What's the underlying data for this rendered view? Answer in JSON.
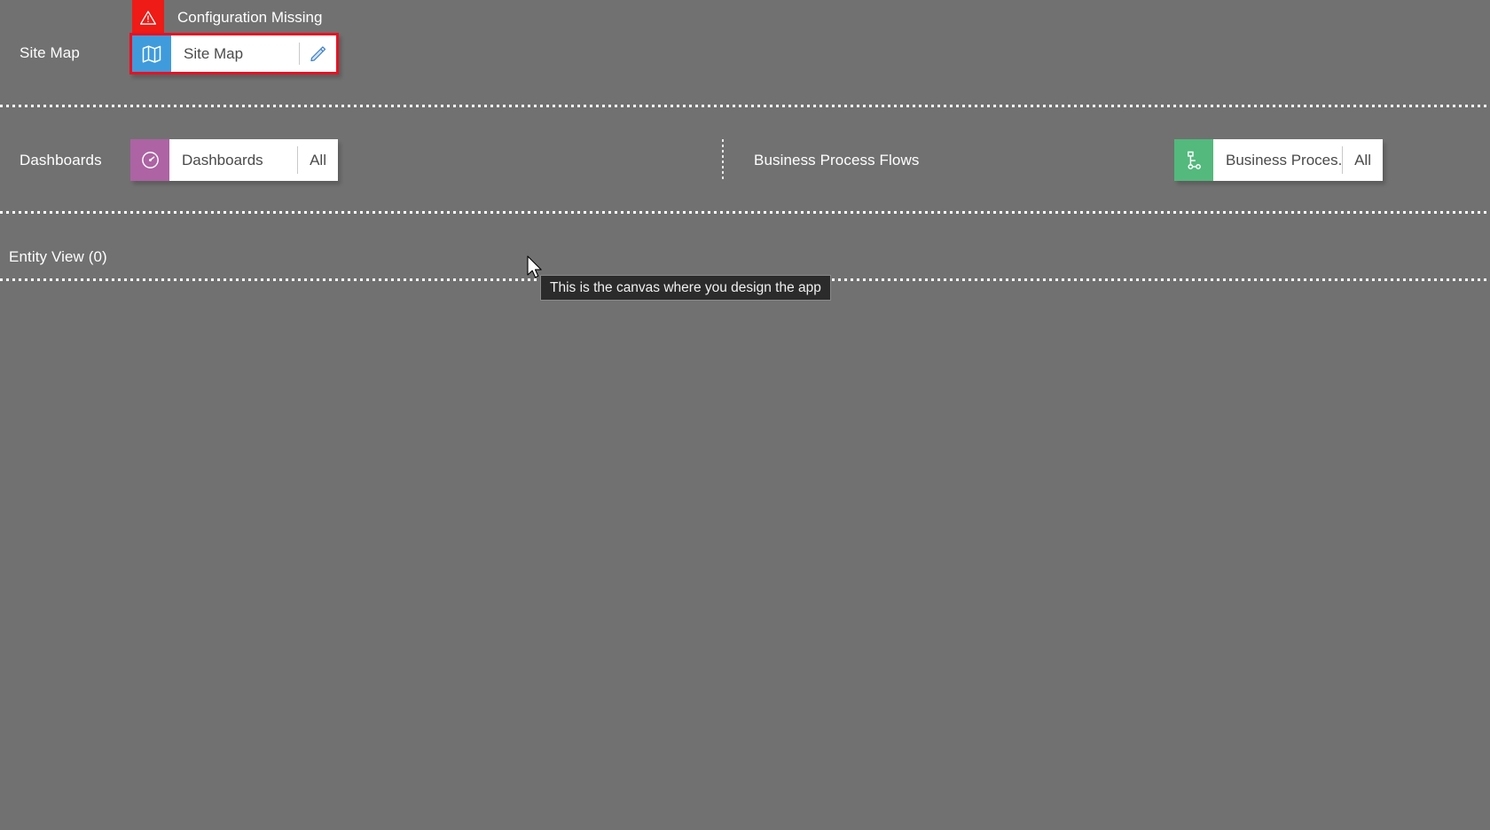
{
  "canvas": {
    "background_color": "#717171",
    "tooltip": {
      "text": "This is the canvas where you design the app"
    }
  },
  "rows": [
    {
      "label": "Site Map",
      "tile": {
        "title": "Site Map",
        "icon": "sitemap-icon",
        "icon_color": "#3f9bdc",
        "tail": "edit-pencil-icon",
        "selected": true,
        "selection_color": "#e81123"
      },
      "banner": {
        "text": "Configuration Missing",
        "icon": "warning-triangle-icon",
        "color": "#ee1b16"
      }
    },
    {
      "label": "Dashboards",
      "tile": {
        "title": "Dashboards",
        "icon": "dashboard-gauge-icon",
        "icon_color": "#ad63a4",
        "tail": "All"
      }
    },
    {
      "label": "Business Process Flows",
      "tile": {
        "title": "Business Proces...",
        "icon": "process-flow-icon",
        "icon_color": "#53b97d",
        "tail": "All"
      }
    },
    {
      "label": "Entity View (0)"
    }
  ]
}
